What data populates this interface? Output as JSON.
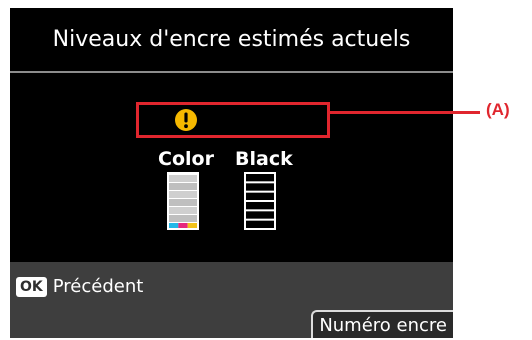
{
  "screen": {
    "title": "Niveaux d'encre estimés actuels",
    "warning_icon": "exclamation-icon",
    "inks": [
      {
        "label": "Color",
        "bands": [
          "#cfcfcf",
          "#bfbfbf",
          "#cfcfcf",
          "#bfbfbf",
          "#cfcfcf",
          "#bfbfbf"
        ],
        "strip_colors": [
          "#22b8e8",
          "#e6287d",
          "#f2c21a"
        ]
      },
      {
        "label": "Black",
        "bars": 5
      }
    ],
    "bottom": {
      "ok_key": "OK",
      "back_label": "Précédent",
      "ink_number_label": "Numéro encre"
    }
  },
  "callout": {
    "label": "(A)",
    "color": "#e0262e"
  }
}
